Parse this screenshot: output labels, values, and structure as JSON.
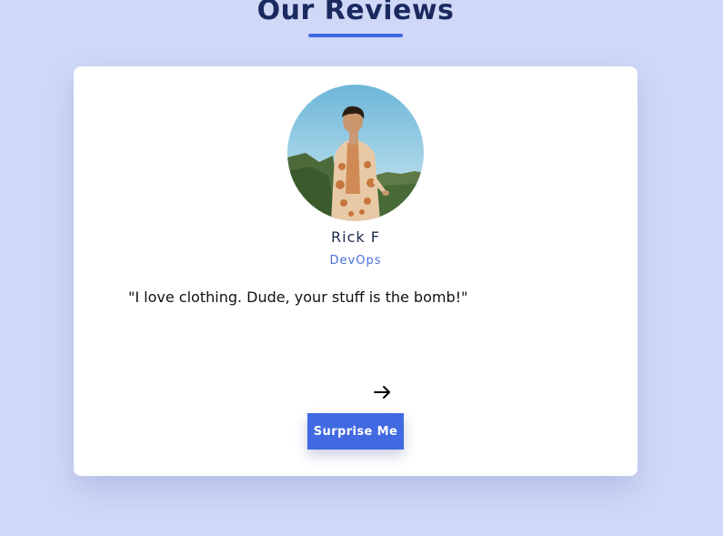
{
  "header": {
    "title": "Our Reviews"
  },
  "review": {
    "name": "Rick F",
    "job": "DevOps",
    "text": "\"I love clothing. Dude, your stuff is the bomb!\"",
    "avatar_alt": "reviewer photo"
  },
  "controls": {
    "next_icon": "arrow-right-icon",
    "surprise_label": "Surprise Me"
  },
  "colors": {
    "background": "#d0d8f7",
    "accent": "#4169e1",
    "title": "#1a2a5e",
    "card": "#ffffff"
  }
}
